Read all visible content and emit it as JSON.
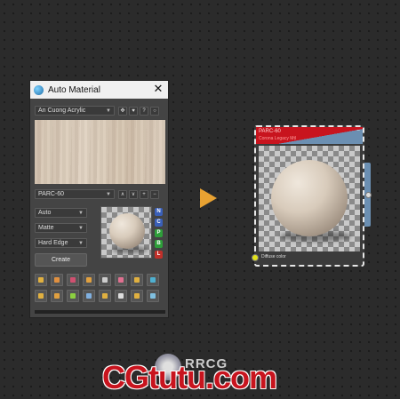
{
  "window": {
    "title": "Auto Material",
    "close_glyph": "✕"
  },
  "library": {
    "selected": "An Cuong Acrylic",
    "buttons": [
      "✥",
      "♥",
      "?",
      "○"
    ]
  },
  "material": {
    "name": "PARC-60",
    "buttons": [
      "∧",
      "∨",
      "+",
      "−"
    ]
  },
  "options": [
    {
      "value": "Auto"
    },
    {
      "value": "Matte"
    },
    {
      "value": "Hard Edge"
    }
  ],
  "letters": [
    {
      "label": "N",
      "color": "#3a5fb8"
    },
    {
      "label": "C",
      "color": "#3a5fb8"
    },
    {
      "label": "P",
      "color": "#2e9e3a"
    },
    {
      "label": "B",
      "color": "#2e9e3a"
    },
    {
      "label": "L",
      "color": "#c0302a"
    }
  ],
  "create_label": "Create",
  "tools": [
    "#e0b040",
    "#e09040",
    "#d05070",
    "#e0a040",
    "#cccccc",
    "#e07090",
    "#e0b040",
    "#4fb0d0",
    "#e0b040",
    "#e0a040",
    "#8ccf40",
    "#80b0e0",
    "#e0b040",
    "#dddddd",
    "#e0b040",
    "#80c0e0"
  ],
  "node": {
    "title": "PARC-60",
    "subtitle": "Corona Legacy Mtl",
    "minimize": "−",
    "socket_label": "Diffuse color"
  },
  "watermark": {
    "small": "RRCG",
    "big": "CGtutu.com"
  },
  "colors": {
    "accent_arrow": "#e8a232",
    "node_header": "#c8141e"
  }
}
